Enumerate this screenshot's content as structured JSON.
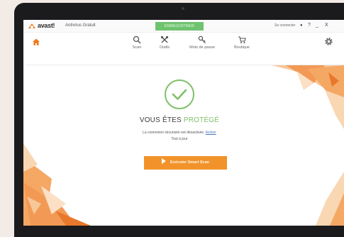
{
  "window": {
    "brand": "avast!",
    "product": "Antivirus Gratuit",
    "register_label": "ENREGISTRER",
    "signin_label": "Se connecter",
    "controls": [
      "?",
      "_",
      "X"
    ]
  },
  "nav": {
    "items": [
      {
        "label": "Scan",
        "icon": "magnifier-icon"
      },
      {
        "label": "Outils",
        "icon": "tools-icon"
      },
      {
        "label": "Mots de passe",
        "icon": "key-icon"
      },
      {
        "label": "Boutique",
        "icon": "cart-icon"
      }
    ]
  },
  "main": {
    "status_prefix": "VOUS ÊTES",
    "status_highlight": "PROTÉGÉ",
    "message": "La connexion sécurisée est désactivée.",
    "message_link": "Activer",
    "update_status": "Tout à jour",
    "scan_button": "Exécuter Smart Scan"
  },
  "colors": {
    "accent_green": "#7fc06a",
    "register_green": "#6fc36f",
    "scan_orange": "#f1932a",
    "home_orange": "#f07a1e"
  }
}
